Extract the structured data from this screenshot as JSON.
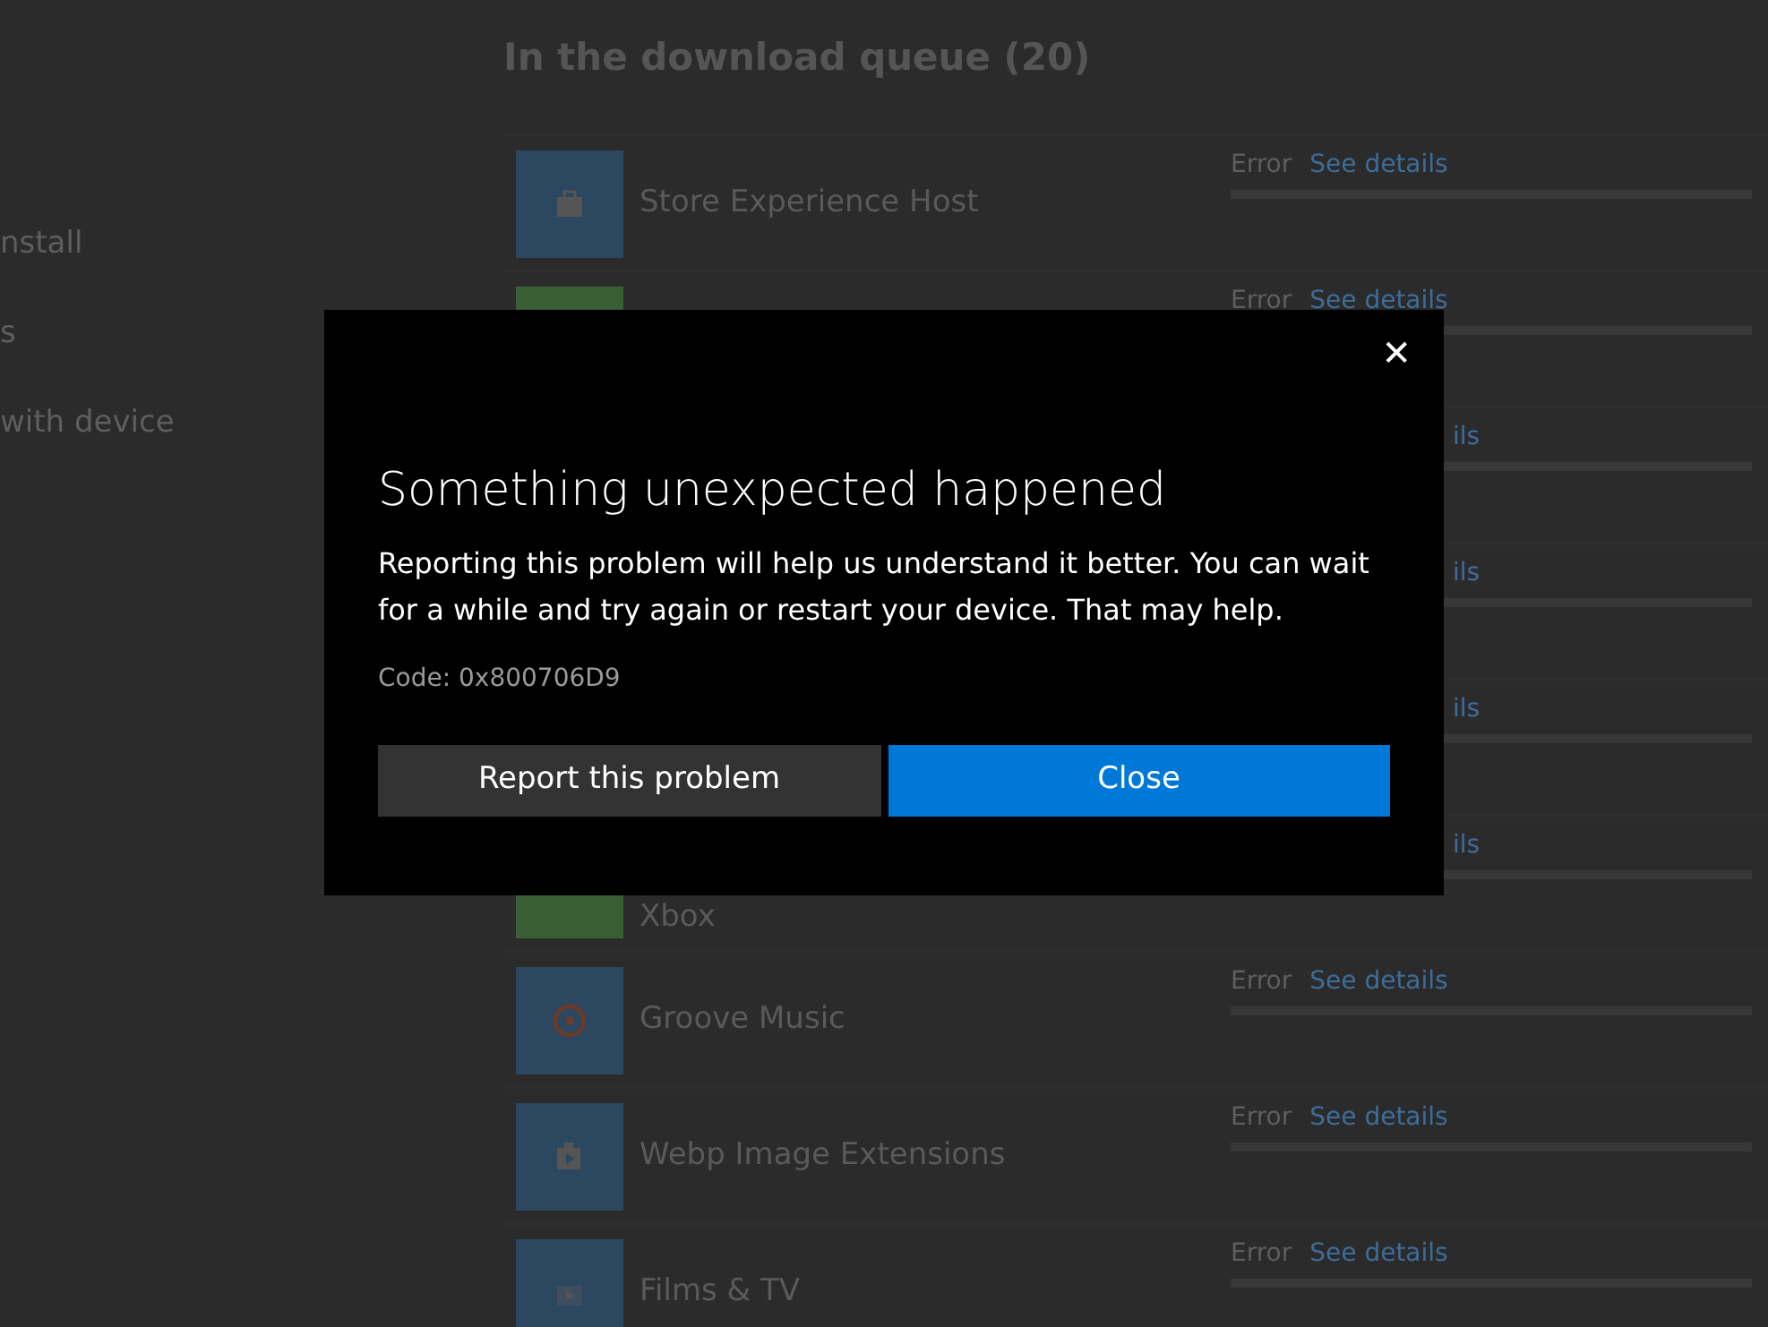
{
  "sidebar": {
    "items": [
      {
        "label": "nstall"
      },
      {
        "label": "s"
      },
      {
        "label": "with device"
      }
    ]
  },
  "queue": {
    "title": "In the download queue (20)",
    "rows": [
      {
        "kind": "full",
        "name": "Store Experience Host",
        "color": "#2c4760",
        "status": "Error",
        "link": "See details"
      },
      {
        "kind": "full",
        "color": "#3a5e35",
        "status": "Error",
        "link": "See details"
      },
      {
        "kind": "covered",
        "fragment": "ils"
      },
      {
        "kind": "covered",
        "fragment": "ils"
      },
      {
        "kind": "covered",
        "fragment": "ils"
      },
      {
        "kind": "covered",
        "name": "Xbox",
        "color": "#3a5e35",
        "fragment": "ils"
      },
      {
        "kind": "full",
        "name": "Groove Music",
        "color": "#2c4760",
        "status": "Error",
        "link": "See details"
      },
      {
        "kind": "full",
        "name": "Webp Image Extensions",
        "color": "#2c4760",
        "status": "Error",
        "link": "See details"
      },
      {
        "kind": "full",
        "name": "Films & TV",
        "color": "#2c4760",
        "status": "Error",
        "link": "See details"
      }
    ]
  },
  "dialog": {
    "close_glyph": "✕",
    "title": "Something unexpected happened",
    "message": "Reporting this problem will help us understand it better. You can wait for a while and try again or restart your device. That may help.",
    "code": "Code: 0x800706D9",
    "buttons": [
      {
        "label": "Report this problem",
        "kind": "secondary"
      },
      {
        "label": "Close",
        "kind": "primary"
      }
    ]
  }
}
